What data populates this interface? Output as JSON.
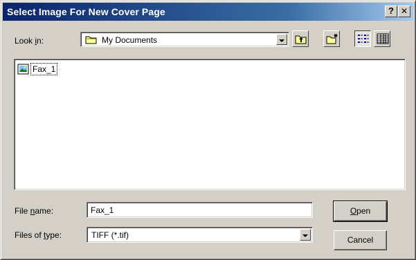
{
  "window": {
    "title": "Select Image For New Cover Page",
    "help_label": "?",
    "close_label": "✕"
  },
  "lookin": {
    "label_pre": "Look ",
    "label_key": "i",
    "label_post": "n:",
    "value": "My Documents"
  },
  "toolbar": [
    {
      "name": "up-one-level",
      "icon": "up-folder-icon"
    },
    {
      "name": "create-new-folder",
      "icon": "new-folder-icon"
    },
    {
      "name": "list-view",
      "icon": "list-view-icon",
      "pressed": true
    },
    {
      "name": "details-view",
      "icon": "details-view-icon"
    }
  ],
  "files": [
    {
      "name": "Fax_1",
      "icon": "image-file-icon"
    }
  ],
  "filename": {
    "label_pre": "File ",
    "label_key": "n",
    "label_post": "ame:",
    "value": "Fax_1"
  },
  "filetype": {
    "label_pre": "Files of ",
    "label_key": "t",
    "label_post": "ype:",
    "value": "TIFF (*.tif)"
  },
  "buttons": {
    "open_key": "O",
    "open_rest": "pen",
    "cancel": "Cancel"
  },
  "colors": {
    "titlebar_start": "#0a246a",
    "titlebar_end": "#a6caf0",
    "face": "#d4d0c8"
  }
}
